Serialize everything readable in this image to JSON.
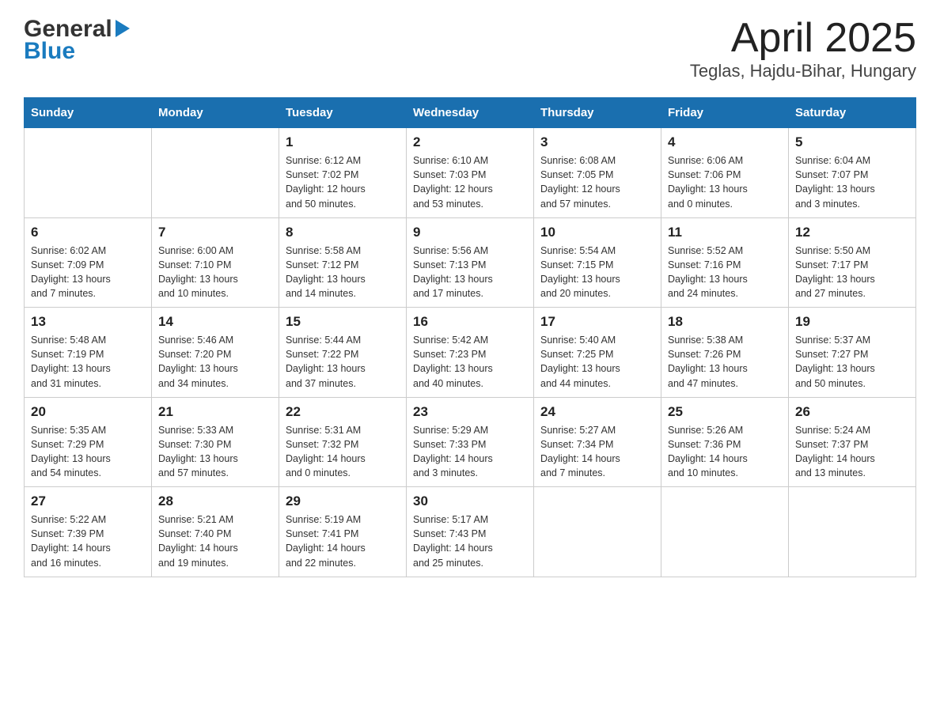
{
  "logo": {
    "line1": "General",
    "line2": "Blue"
  },
  "title": "April 2025",
  "subtitle": "Teglas, Hajdu-Bihar, Hungary",
  "days_of_week": [
    "Sunday",
    "Monday",
    "Tuesday",
    "Wednesday",
    "Thursday",
    "Friday",
    "Saturday"
  ],
  "weeks": [
    [
      {
        "day": "",
        "info": ""
      },
      {
        "day": "",
        "info": ""
      },
      {
        "day": "1",
        "info": "Sunrise: 6:12 AM\nSunset: 7:02 PM\nDaylight: 12 hours\nand 50 minutes."
      },
      {
        "day": "2",
        "info": "Sunrise: 6:10 AM\nSunset: 7:03 PM\nDaylight: 12 hours\nand 53 minutes."
      },
      {
        "day": "3",
        "info": "Sunrise: 6:08 AM\nSunset: 7:05 PM\nDaylight: 12 hours\nand 57 minutes."
      },
      {
        "day": "4",
        "info": "Sunrise: 6:06 AM\nSunset: 7:06 PM\nDaylight: 13 hours\nand 0 minutes."
      },
      {
        "day": "5",
        "info": "Sunrise: 6:04 AM\nSunset: 7:07 PM\nDaylight: 13 hours\nand 3 minutes."
      }
    ],
    [
      {
        "day": "6",
        "info": "Sunrise: 6:02 AM\nSunset: 7:09 PM\nDaylight: 13 hours\nand 7 minutes."
      },
      {
        "day": "7",
        "info": "Sunrise: 6:00 AM\nSunset: 7:10 PM\nDaylight: 13 hours\nand 10 minutes."
      },
      {
        "day": "8",
        "info": "Sunrise: 5:58 AM\nSunset: 7:12 PM\nDaylight: 13 hours\nand 14 minutes."
      },
      {
        "day": "9",
        "info": "Sunrise: 5:56 AM\nSunset: 7:13 PM\nDaylight: 13 hours\nand 17 minutes."
      },
      {
        "day": "10",
        "info": "Sunrise: 5:54 AM\nSunset: 7:15 PM\nDaylight: 13 hours\nand 20 minutes."
      },
      {
        "day": "11",
        "info": "Sunrise: 5:52 AM\nSunset: 7:16 PM\nDaylight: 13 hours\nand 24 minutes."
      },
      {
        "day": "12",
        "info": "Sunrise: 5:50 AM\nSunset: 7:17 PM\nDaylight: 13 hours\nand 27 minutes."
      }
    ],
    [
      {
        "day": "13",
        "info": "Sunrise: 5:48 AM\nSunset: 7:19 PM\nDaylight: 13 hours\nand 31 minutes."
      },
      {
        "day": "14",
        "info": "Sunrise: 5:46 AM\nSunset: 7:20 PM\nDaylight: 13 hours\nand 34 minutes."
      },
      {
        "day": "15",
        "info": "Sunrise: 5:44 AM\nSunset: 7:22 PM\nDaylight: 13 hours\nand 37 minutes."
      },
      {
        "day": "16",
        "info": "Sunrise: 5:42 AM\nSunset: 7:23 PM\nDaylight: 13 hours\nand 40 minutes."
      },
      {
        "day": "17",
        "info": "Sunrise: 5:40 AM\nSunset: 7:25 PM\nDaylight: 13 hours\nand 44 minutes."
      },
      {
        "day": "18",
        "info": "Sunrise: 5:38 AM\nSunset: 7:26 PM\nDaylight: 13 hours\nand 47 minutes."
      },
      {
        "day": "19",
        "info": "Sunrise: 5:37 AM\nSunset: 7:27 PM\nDaylight: 13 hours\nand 50 minutes."
      }
    ],
    [
      {
        "day": "20",
        "info": "Sunrise: 5:35 AM\nSunset: 7:29 PM\nDaylight: 13 hours\nand 54 minutes."
      },
      {
        "day": "21",
        "info": "Sunrise: 5:33 AM\nSunset: 7:30 PM\nDaylight: 13 hours\nand 57 minutes."
      },
      {
        "day": "22",
        "info": "Sunrise: 5:31 AM\nSunset: 7:32 PM\nDaylight: 14 hours\nand 0 minutes."
      },
      {
        "day": "23",
        "info": "Sunrise: 5:29 AM\nSunset: 7:33 PM\nDaylight: 14 hours\nand 3 minutes."
      },
      {
        "day": "24",
        "info": "Sunrise: 5:27 AM\nSunset: 7:34 PM\nDaylight: 14 hours\nand 7 minutes."
      },
      {
        "day": "25",
        "info": "Sunrise: 5:26 AM\nSunset: 7:36 PM\nDaylight: 14 hours\nand 10 minutes."
      },
      {
        "day": "26",
        "info": "Sunrise: 5:24 AM\nSunset: 7:37 PM\nDaylight: 14 hours\nand 13 minutes."
      }
    ],
    [
      {
        "day": "27",
        "info": "Sunrise: 5:22 AM\nSunset: 7:39 PM\nDaylight: 14 hours\nand 16 minutes."
      },
      {
        "day": "28",
        "info": "Sunrise: 5:21 AM\nSunset: 7:40 PM\nDaylight: 14 hours\nand 19 minutes."
      },
      {
        "day": "29",
        "info": "Sunrise: 5:19 AM\nSunset: 7:41 PM\nDaylight: 14 hours\nand 22 minutes."
      },
      {
        "day": "30",
        "info": "Sunrise: 5:17 AM\nSunset: 7:43 PM\nDaylight: 14 hours\nand 25 minutes."
      },
      {
        "day": "",
        "info": ""
      },
      {
        "day": "",
        "info": ""
      },
      {
        "day": "",
        "info": ""
      }
    ]
  ]
}
